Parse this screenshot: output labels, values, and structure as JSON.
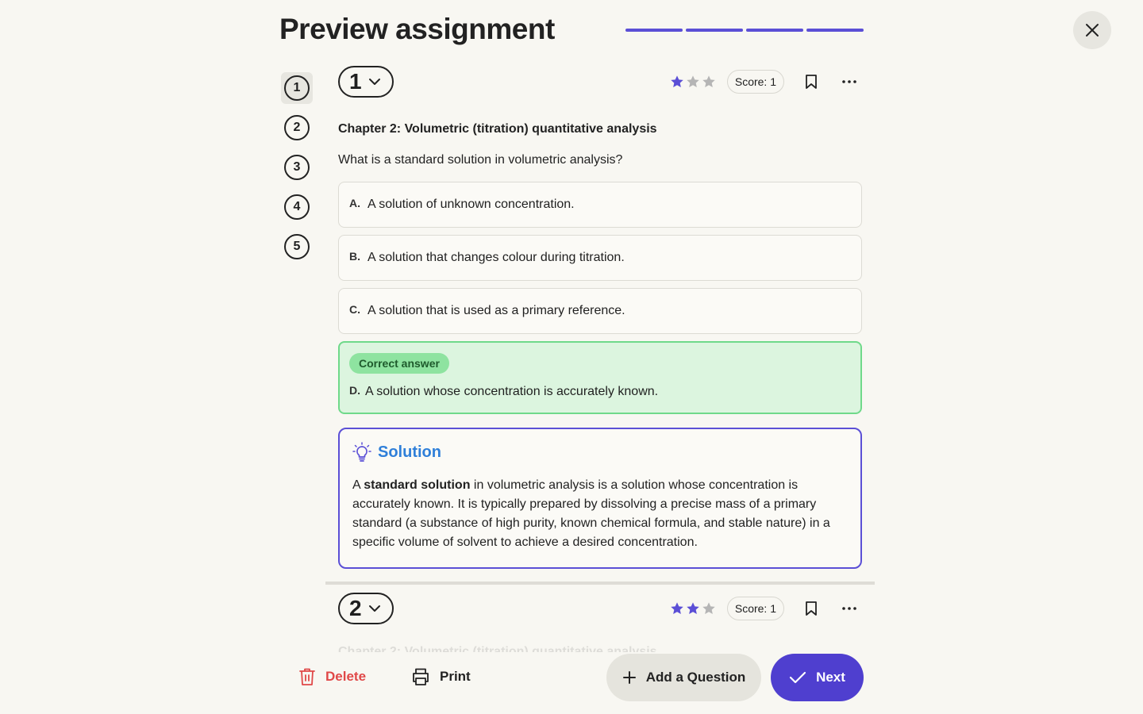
{
  "page": {
    "title": "Preview assignment",
    "progress_segments": 4
  },
  "nav": [
    "1",
    "2",
    "3",
    "4",
    "5"
  ],
  "questions": [
    {
      "number": "1",
      "difficulty": 1,
      "score": "Score: 1",
      "chapter": "Chapter 2: Volumetric (titration) quantitative analysis",
      "text": "What is a standard solution in volumetric analysis?",
      "options": [
        {
          "letter": "A.",
          "text": "A solution of unknown concentration."
        },
        {
          "letter": "B.",
          "text": "A solution that changes colour during titration."
        },
        {
          "letter": "C.",
          "text": "A solution that is used as a primary reference."
        }
      ],
      "correct": {
        "tag": "Correct answer",
        "letter": "D.",
        "text": "A solution whose concentration is accurately known."
      },
      "solution": {
        "title": "Solution",
        "prefix": "A ",
        "bold": "standard solution",
        "rest": " in volumetric analysis is a solution whose concentration is accurately known. It is typically prepared by dissolving a precise mass of a primary standard (a substance of high purity, known chemical formula, and stable nature) in a specific volume of solvent to achieve a desired concentration."
      }
    },
    {
      "number": "2",
      "difficulty": 2,
      "score": "Score: 1",
      "chapter": "Chapter 2: Volumetric (titration) quantitative analysis"
    }
  ],
  "footer": {
    "delete": "Delete",
    "print": "Print",
    "add": "Add a Question",
    "next": "Next"
  },
  "colors": {
    "accent": "#5b4fd6",
    "star_on": "#5b4fd6",
    "star_off": "#b5b5b5",
    "correct_bg": "#dcf5df",
    "delete": "#e04848"
  }
}
